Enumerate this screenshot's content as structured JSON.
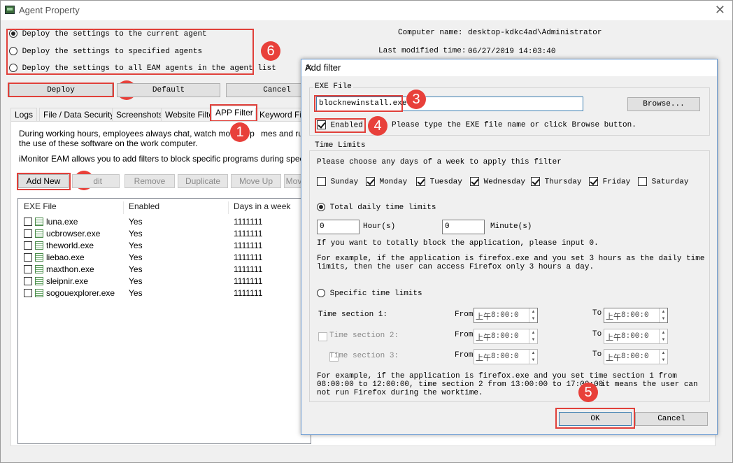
{
  "window": {
    "title": "Agent Property"
  },
  "deploy_options": [
    {
      "label": "Deploy the settings to the current agent",
      "selected": true
    },
    {
      "label": "Deploy the settings to specified agents",
      "selected": false
    },
    {
      "label": "Deploy the settings to all EAM agents in the agent list",
      "selected": false
    }
  ],
  "computer_info": {
    "name_label": "Computer name:",
    "name_value": "desktop-kdkc4ad\\Administrator",
    "modified_label": "Last modified time:",
    "modified_value": "06/27/2019 14:03:40"
  },
  "actions": {
    "deploy": "Deploy",
    "default": "Default",
    "cancel": "Cancel"
  },
  "tabs": [
    "Logs",
    "File / Data Security",
    "Screenshots",
    "Website Filter",
    "APP Filter",
    "Keyword Filte"
  ],
  "app_filter": {
    "description1": "During working hours, employees always chat,  watch movies, p",
    "description1b": "mes and run othe",
    "description2": "the use of these software on the work computer.",
    "description3": "iMonitor EAM allows you to add filters to block specific programs during specific time.",
    "buttons": {
      "add_new": "Add New",
      "edit": "dit",
      "remove": "Remove",
      "duplicate": "Duplicate",
      "move_up": "Move Up",
      "move_down": "Mov"
    },
    "columns": [
      "EXE File",
      "Enabled",
      "Days in a week"
    ],
    "rows": [
      {
        "exe": "luna.exe",
        "enabled": "Yes",
        "days": "1111111"
      },
      {
        "exe": "ucbrowser.exe",
        "enabled": "Yes",
        "days": "1111111"
      },
      {
        "exe": "theworld.exe",
        "enabled": "Yes",
        "days": "1111111"
      },
      {
        "exe": "liebao.exe",
        "enabled": "Yes",
        "days": "1111111"
      },
      {
        "exe": "maxthon.exe",
        "enabled": "Yes",
        "days": "1111111"
      },
      {
        "exe": "sleipnir.exe",
        "enabled": "Yes",
        "days": "1111111"
      },
      {
        "exe": "sogouexplorer.exe",
        "enabled": "Yes",
        "days": "1111111"
      }
    ]
  },
  "dialog": {
    "title": "Add filter",
    "exe_group_label": "EXE File",
    "exe_value": "blocknewinstall.exe",
    "browse": "Browse...",
    "enabled_label": "Enabled",
    "enabled_checked": true,
    "exe_hint": "Please type the EXE file name or click Browse button.",
    "time_group_label": "Time Limits",
    "days_hint": "Please choose any days of a week to apply this filter",
    "days": [
      {
        "label": "Sunday",
        "checked": false
      },
      {
        "label": "Monday",
        "checked": true
      },
      {
        "label": "Tuesday",
        "checked": true
      },
      {
        "label": "Wednesday",
        "checked": true
      },
      {
        "label": "Thursday",
        "checked": true
      },
      {
        "label": "Friday",
        "checked": true
      },
      {
        "label": "Saturday",
        "checked": false
      }
    ],
    "total_label": "Total daily time limits",
    "hours_value": "0",
    "hours_label": "Hour(s)",
    "minutes_value": "0",
    "minutes_label": "Minute(s)",
    "block_hint": "If you want to totally block the application, please input 0.",
    "example1_line1": "For example, if the application is firefox.exe and you set 3 hours  as the daily time",
    "example1_line2": "limits, then the user can access Firefox only 3 hours a day.",
    "specific_label": "Specific time limits",
    "sections": [
      {
        "label": "Time section 1:",
        "from": "From",
        "to": "To",
        "ampm": "上午",
        "from_time": "8:00:0",
        "to_time": "8:00:0"
      },
      {
        "label": "Time section 2:",
        "from": "From",
        "to": "To",
        "ampm": "上午",
        "from_time": "8:00:0",
        "to_time": "8:00:0"
      },
      {
        "label": "Time section 3:",
        "from": "From",
        "to": "To",
        "ampm": "上午",
        "from_time": "8:00:0",
        "to_time": "8:00:0"
      }
    ],
    "example2_line1": "For example, if the application is firefox.exe and you set  time section 1 from",
    "example2_line2": "08:00:00 to 12:00:00, time section 2 from 13:00:00 to 17:00:00",
    "example2_line2b": "it means the user can",
    "example2_line3": "not run Firefox during the worktime.",
    "ok": "OK",
    "cancel": "Cancel"
  },
  "badges": [
    "1",
    "2",
    "3",
    "4",
    "5",
    "6",
    "7"
  ],
  "colors": {
    "annotation_red": "#e0403a",
    "badge_red": "#e8403a"
  }
}
